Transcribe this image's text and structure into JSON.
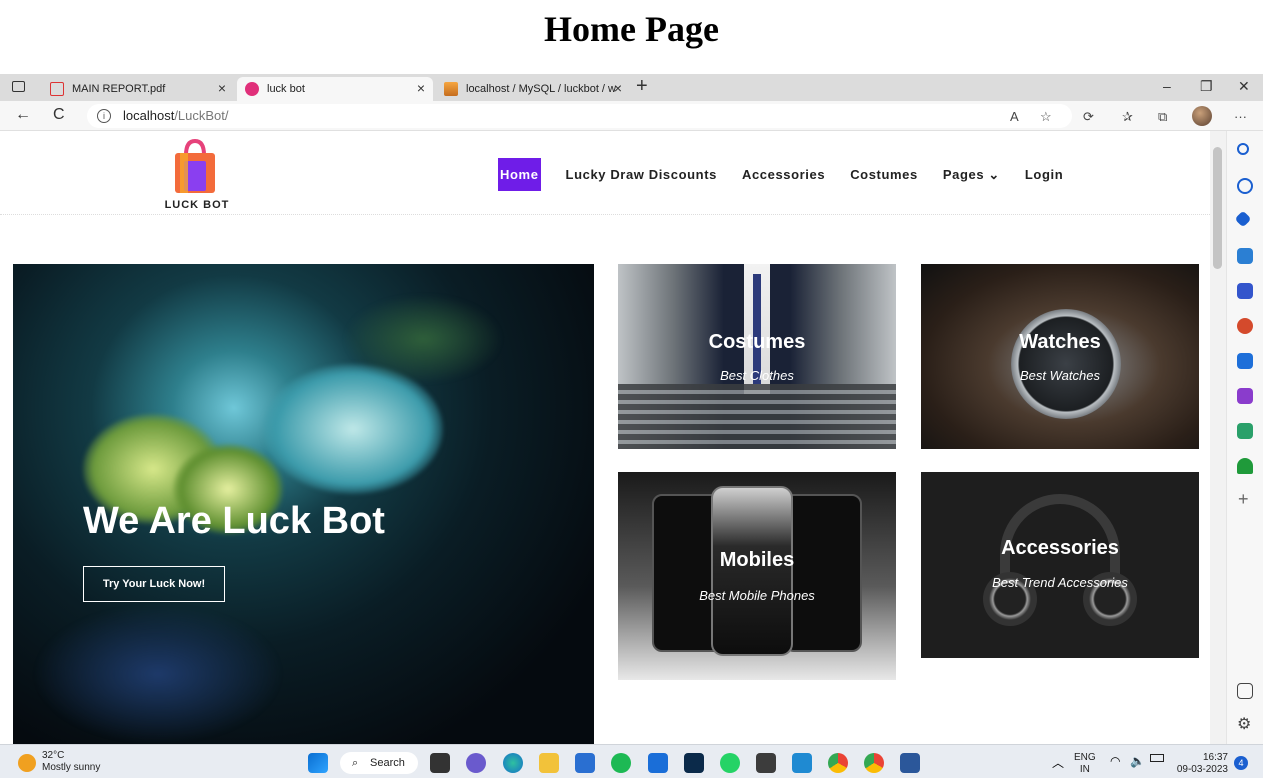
{
  "caption": "Home Page",
  "browser": {
    "tabs": [
      {
        "label": "MAIN REPORT.pdf",
        "close": "×"
      },
      {
        "label": "luck bot",
        "close": "×"
      },
      {
        "label": "localhost / MySQL / luckbot / wi",
        "close": "×"
      }
    ],
    "new_tab": "+",
    "window_controls": {
      "minimize": "–",
      "restore": "❐",
      "close": "✕"
    },
    "url_host": "localhost",
    "url_path": "/LuckBot/",
    "nav": {
      "back": "←",
      "reload": "C",
      "more": "···"
    }
  },
  "site": {
    "logo_text": "LUCK BOT",
    "menu": [
      {
        "label": "Home",
        "active": true
      },
      {
        "label": "Lucky Draw Discounts"
      },
      {
        "label": "Accessories"
      },
      {
        "label": "Costumes"
      },
      {
        "label": "Pages ⌄"
      },
      {
        "label": "Login"
      }
    ],
    "hero": {
      "title": "We Are Luck Bot",
      "button": "Try Your Luck Now!"
    },
    "cards": [
      {
        "title": "Costumes",
        "subtitle": "Best Clothes"
      },
      {
        "title": "Watches",
        "subtitle": "Best Watches"
      },
      {
        "title": "Mobiles",
        "subtitle": "Best Mobile Phones"
      },
      {
        "title": "Accessories",
        "subtitle": "Best Trend Accessories"
      }
    ]
  },
  "taskbar": {
    "temperature": "32°C",
    "weather": "Mostly sunny",
    "search": "Search",
    "lang_top": "ENG",
    "lang_bottom": "IN",
    "time": "16:37",
    "date": "09-03-2023",
    "notifications": "4"
  },
  "colors": {
    "accent": "#6f1de8"
  }
}
